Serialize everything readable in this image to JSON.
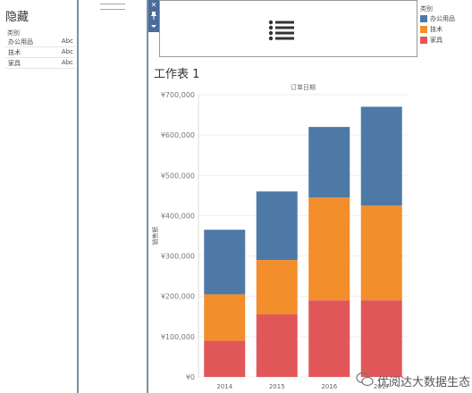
{
  "hidden_panel": {
    "title": "隐藏",
    "header": "类别",
    "rows": [
      {
        "name": "办公用品",
        "abbr": "Abc"
      },
      {
        "name": "技术",
        "abbr": "Abc"
      },
      {
        "name": "家具",
        "abbr": "Abc"
      }
    ]
  },
  "toolbar": {
    "close_icon": "close-icon",
    "pin_icon": "pin-icon",
    "dropdown_icon": "chevron-down-icon"
  },
  "menu": {
    "icon": "list-icon"
  },
  "legend": {
    "title": "类别",
    "items": [
      {
        "label": "办公用品",
        "color": "#4e79a7"
      },
      {
        "label": "技术",
        "color": "#f28e2b"
      },
      {
        "label": "家具",
        "color": "#e15759"
      }
    ]
  },
  "worksheet": {
    "title": "工作表 1"
  },
  "chart_data": {
    "type": "bar",
    "stacked": true,
    "title": "订单日期",
    "xlabel": "",
    "ylabel": "销售额",
    "categories": [
      "2014",
      "2015",
      "2016",
      "2017"
    ],
    "series": [
      {
        "name": "家具",
        "color": "#e15759",
        "values": [
          90000,
          155000,
          190000,
          190000
        ]
      },
      {
        "name": "技术",
        "color": "#f28e2b",
        "values": [
          115000,
          135000,
          255000,
          235000
        ]
      },
      {
        "name": "办公用品",
        "color": "#4e79a7",
        "values": [
          160000,
          170000,
          175000,
          245000
        ]
      }
    ],
    "ylim": [
      0,
      700000
    ],
    "yticks": [
      0,
      100000,
      200000,
      300000,
      400000,
      500000,
      600000,
      700000
    ],
    "ytick_labels": [
      "¥0",
      "¥100,000",
      "¥200,000",
      "¥300,000",
      "¥400,000",
      "¥500,000",
      "¥600,000",
      "¥700,000"
    ],
    "grid": true
  },
  "watermark": {
    "text": "优阅达大数据生态"
  }
}
